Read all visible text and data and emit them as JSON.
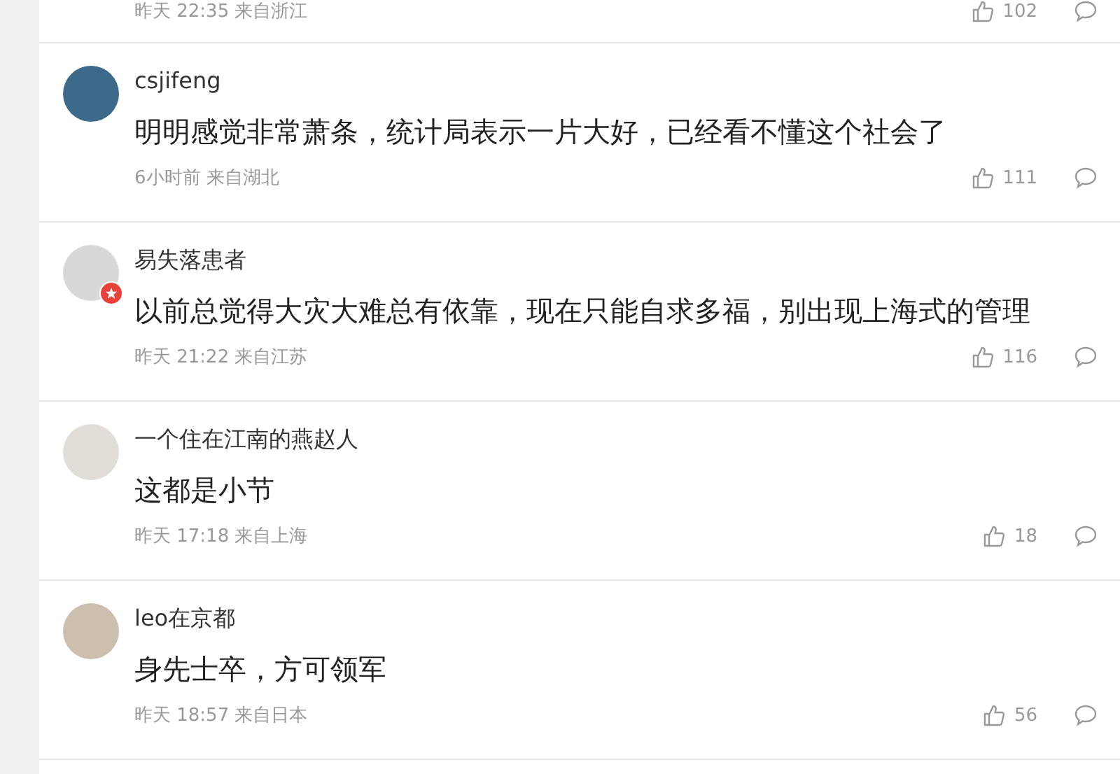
{
  "previous_comment": {
    "meta": "昨天 22:35 来自浙江",
    "likes": "102"
  },
  "comments": [
    {
      "author": "csjifeng",
      "verified": false,
      "text": "明明感觉非常萧条，统计局表示一片大好，已经看不懂这个社会了",
      "meta": "6小时前 来自湖北",
      "likes": "111"
    },
    {
      "author": "易失落患者",
      "verified": true,
      "text": "以前总觉得大灾大难总有依靠，现在只能自求多福，别出现上海式的管理",
      "meta": "昨天 21:22 来自江苏",
      "likes": "116"
    },
    {
      "author": "一个住在江南的燕赵人",
      "verified": false,
      "text": "这都是小节",
      "meta": "昨天 17:18 来自上海",
      "likes": "18"
    },
    {
      "author": "leo在京都",
      "verified": false,
      "text": "身先士卒，方可领军",
      "meta": "昨天 18:57 来自日本",
      "likes": "56"
    }
  ]
}
